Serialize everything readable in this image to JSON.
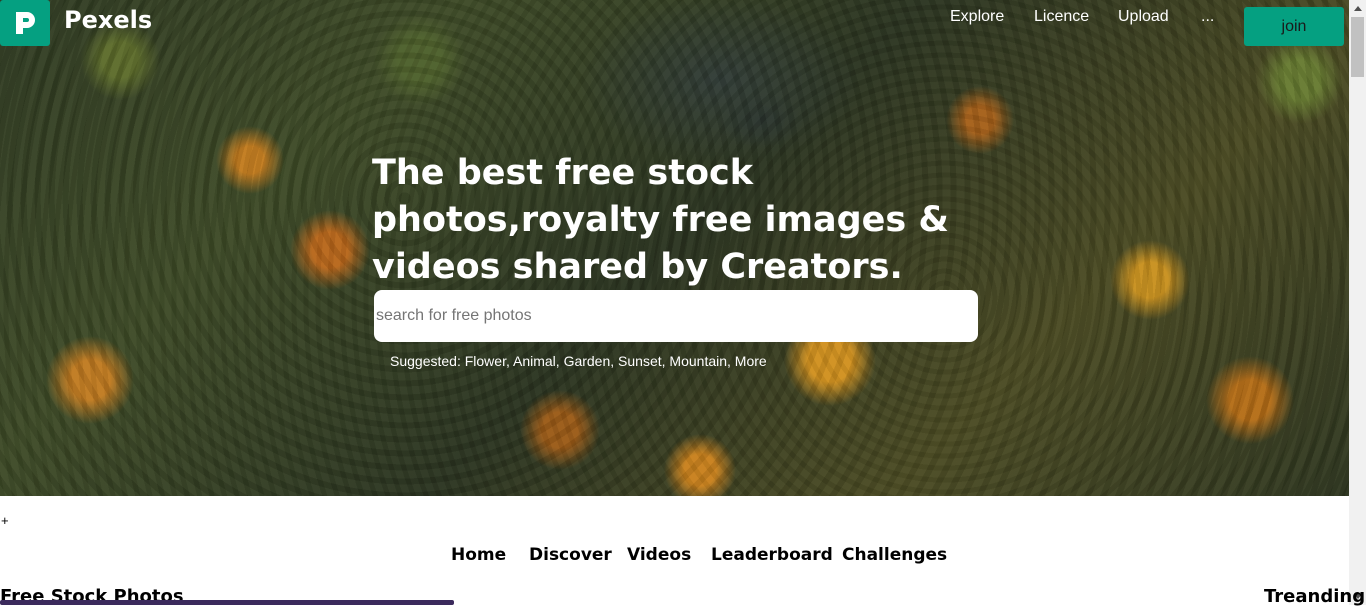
{
  "brand": {
    "name": "Pexels",
    "accent": "#05a081"
  },
  "topnav": {
    "items": [
      "Explore",
      "Licence",
      "Upload",
      "..."
    ],
    "join_label": "join"
  },
  "hero": {
    "headline": "The best free stock photos,royalty free images & videos shared by Creators.",
    "search_placeholder": "search for free photos",
    "suggested_prefix": "Suggested:",
    "suggested": [
      "Flower,",
      "Animal,",
      "Garden,",
      "Sunset,",
      "Mountain,",
      "More"
    ]
  },
  "plus_symbol": "+",
  "mainnav": [
    "Home",
    "Discover",
    "Videos",
    "Leaderboard",
    "Challenges"
  ],
  "sections": {
    "left_title": "Free Stock Photos",
    "right_title": "Treanding"
  },
  "icons": {
    "logo": "pexels-logo-icon",
    "scroll_up": "triangle-up-icon",
    "scroll_down": "triangle-down-icon"
  }
}
